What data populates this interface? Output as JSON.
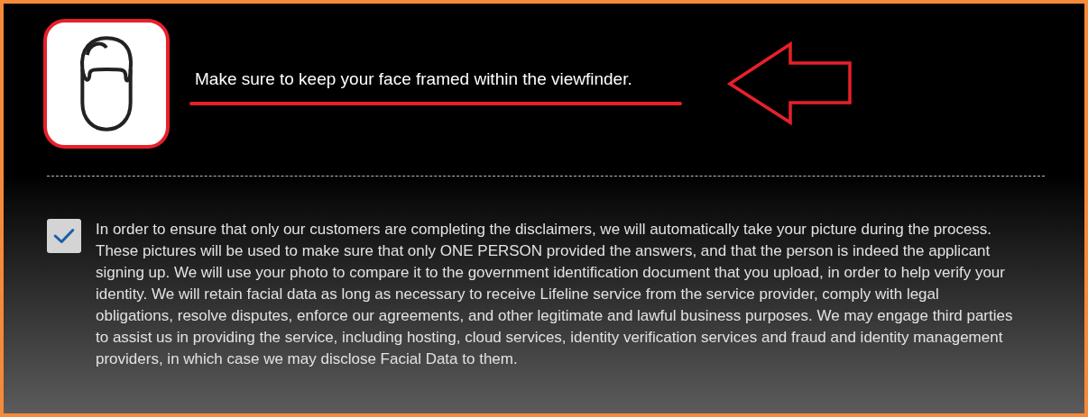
{
  "instruction": "Make sure to keep your face framed within the viewfinder.",
  "consent": {
    "checked": true,
    "text": "In order to ensure that only our customers are completing the disclaimers, we will automatically take your picture during the process. These pictures will be used to make sure that only ONE PERSON provided the answers, and that the person is indeed the applicant signing up. We will use your photo to compare it to the government identification document that you upload, in order to help verify your identity. We will retain facial data as long as necessary to receive Lifeline service from the service provider, comply with legal obligations, resolve disputes, enforce our agreements, and other legitimate and lawful business purposes. We may engage third parties to assist us in providing the service, including hosting, cloud services, identity verification services and fraud and identity management providers, in which case we may disclose Facial Data to them."
  }
}
